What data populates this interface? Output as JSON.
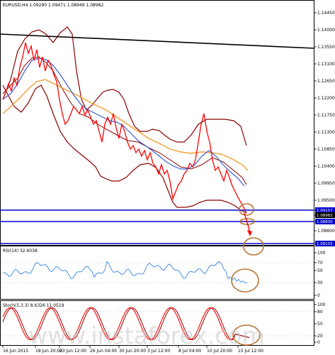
{
  "header": {
    "symbol_line": "EURUSD,H4  1.09290 1.09471 1.08949 1.08982"
  },
  "main_axis": {
    "labels": [
      "1.14450",
      "1.14000",
      "1.13550",
      "1.13100",
      "1.12650",
      "1.12200",
      "1.11750",
      "1.11300",
      "1.10850",
      "1.10400",
      "1.09950",
      "1.09500",
      "1.09157",
      "1.08982",
      "1.08830",
      "1.08600",
      "1.08155"
    ]
  },
  "highlights": [
    "1.09157",
    "1.08982",
    "1.08830",
    "1.08155"
  ],
  "rsi": {
    "title": "RSI(14) 32.6038",
    "labels": [
      "100",
      "70",
      "50",
      "30",
      "0"
    ]
  },
  "stoch": {
    "title": "Stoch(5,3,3) 8.6326 11.0519",
    "labels": [
      "100",
      "80",
      "50",
      "20",
      "0"
    ]
  },
  "time_axis": [
    "16 Jun 2015",
    "18 Jun 20:00",
    "23 Jun 12:00",
    "26 Jun 04:00",
    "30 Jun 20:00",
    "3 Jul 12:00",
    "8 Jul 04:00",
    "10 Jul 20:00",
    "15 Jul 12:00"
  ],
  "watermark": "www.instaforex.com",
  "colors": {
    "price_line": "#ff0000",
    "bollinger": "#8b0000",
    "ma_fast": "#3c5fd8",
    "ma_slow": "#f0a030",
    "support_lines": "#0000cc",
    "rsi_line": "#4a90e2",
    "stoch_main": "#ff0000",
    "stoch_signal": "#8b0000",
    "annotation_circle": "#b87333"
  }
}
